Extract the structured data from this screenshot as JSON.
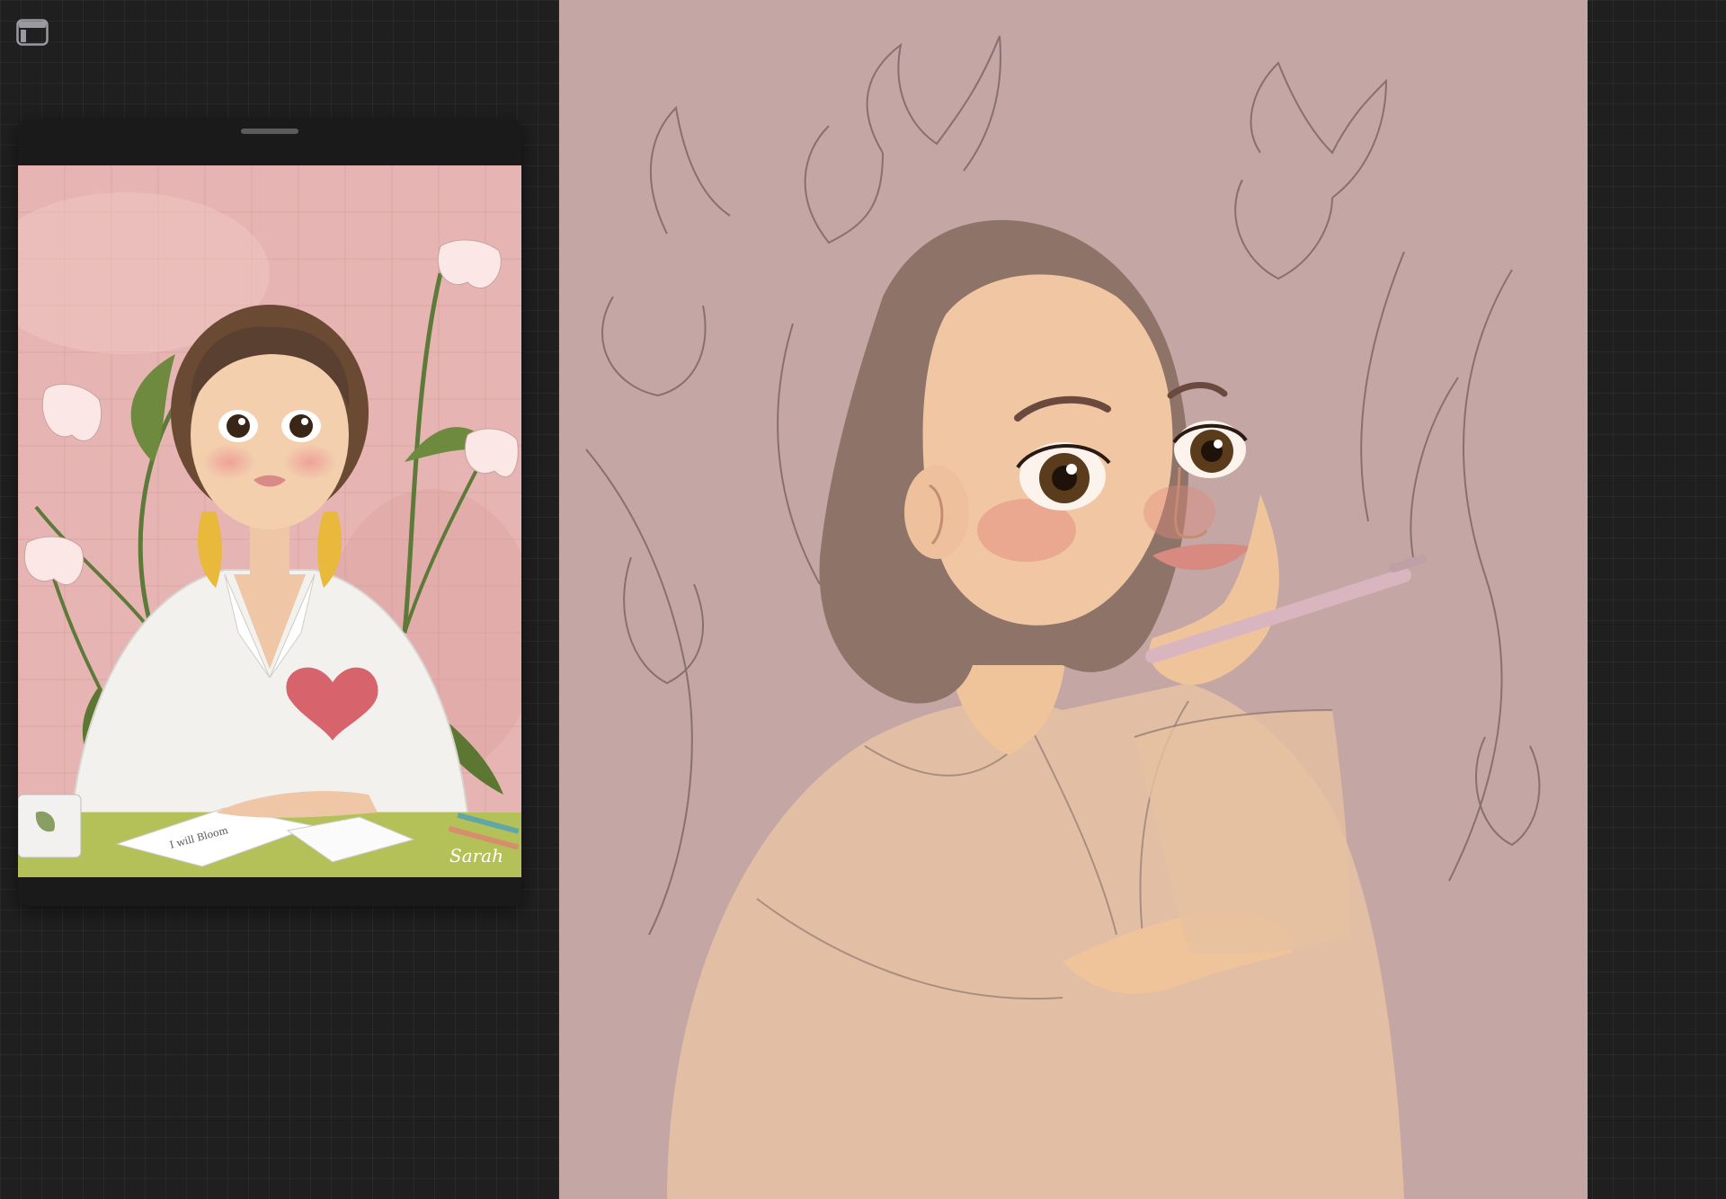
{
  "app": {
    "background_color": "#1f1f20",
    "toggle_icon": "sidebar-panel-icon"
  },
  "reference_panel": {
    "grabber_icon": "drag-handle",
    "image": {
      "subject": "painted portrait: girl at desk with lilies, white shirt, heart patch",
      "palette": {
        "wall": "#e7b7b5",
        "desk": "#b4c158",
        "shirt": "#f2f0ec",
        "hair": "#5a4030",
        "heart": "#d7646c"
      },
      "signature_text": "Sarah",
      "letter_text": "I will Bloom"
    }
  },
  "canvas": {
    "background_color": "#c4a6a4",
    "subject": "sketch portrait: woman resting chin on hand, holding pencil, floral line art"
  }
}
